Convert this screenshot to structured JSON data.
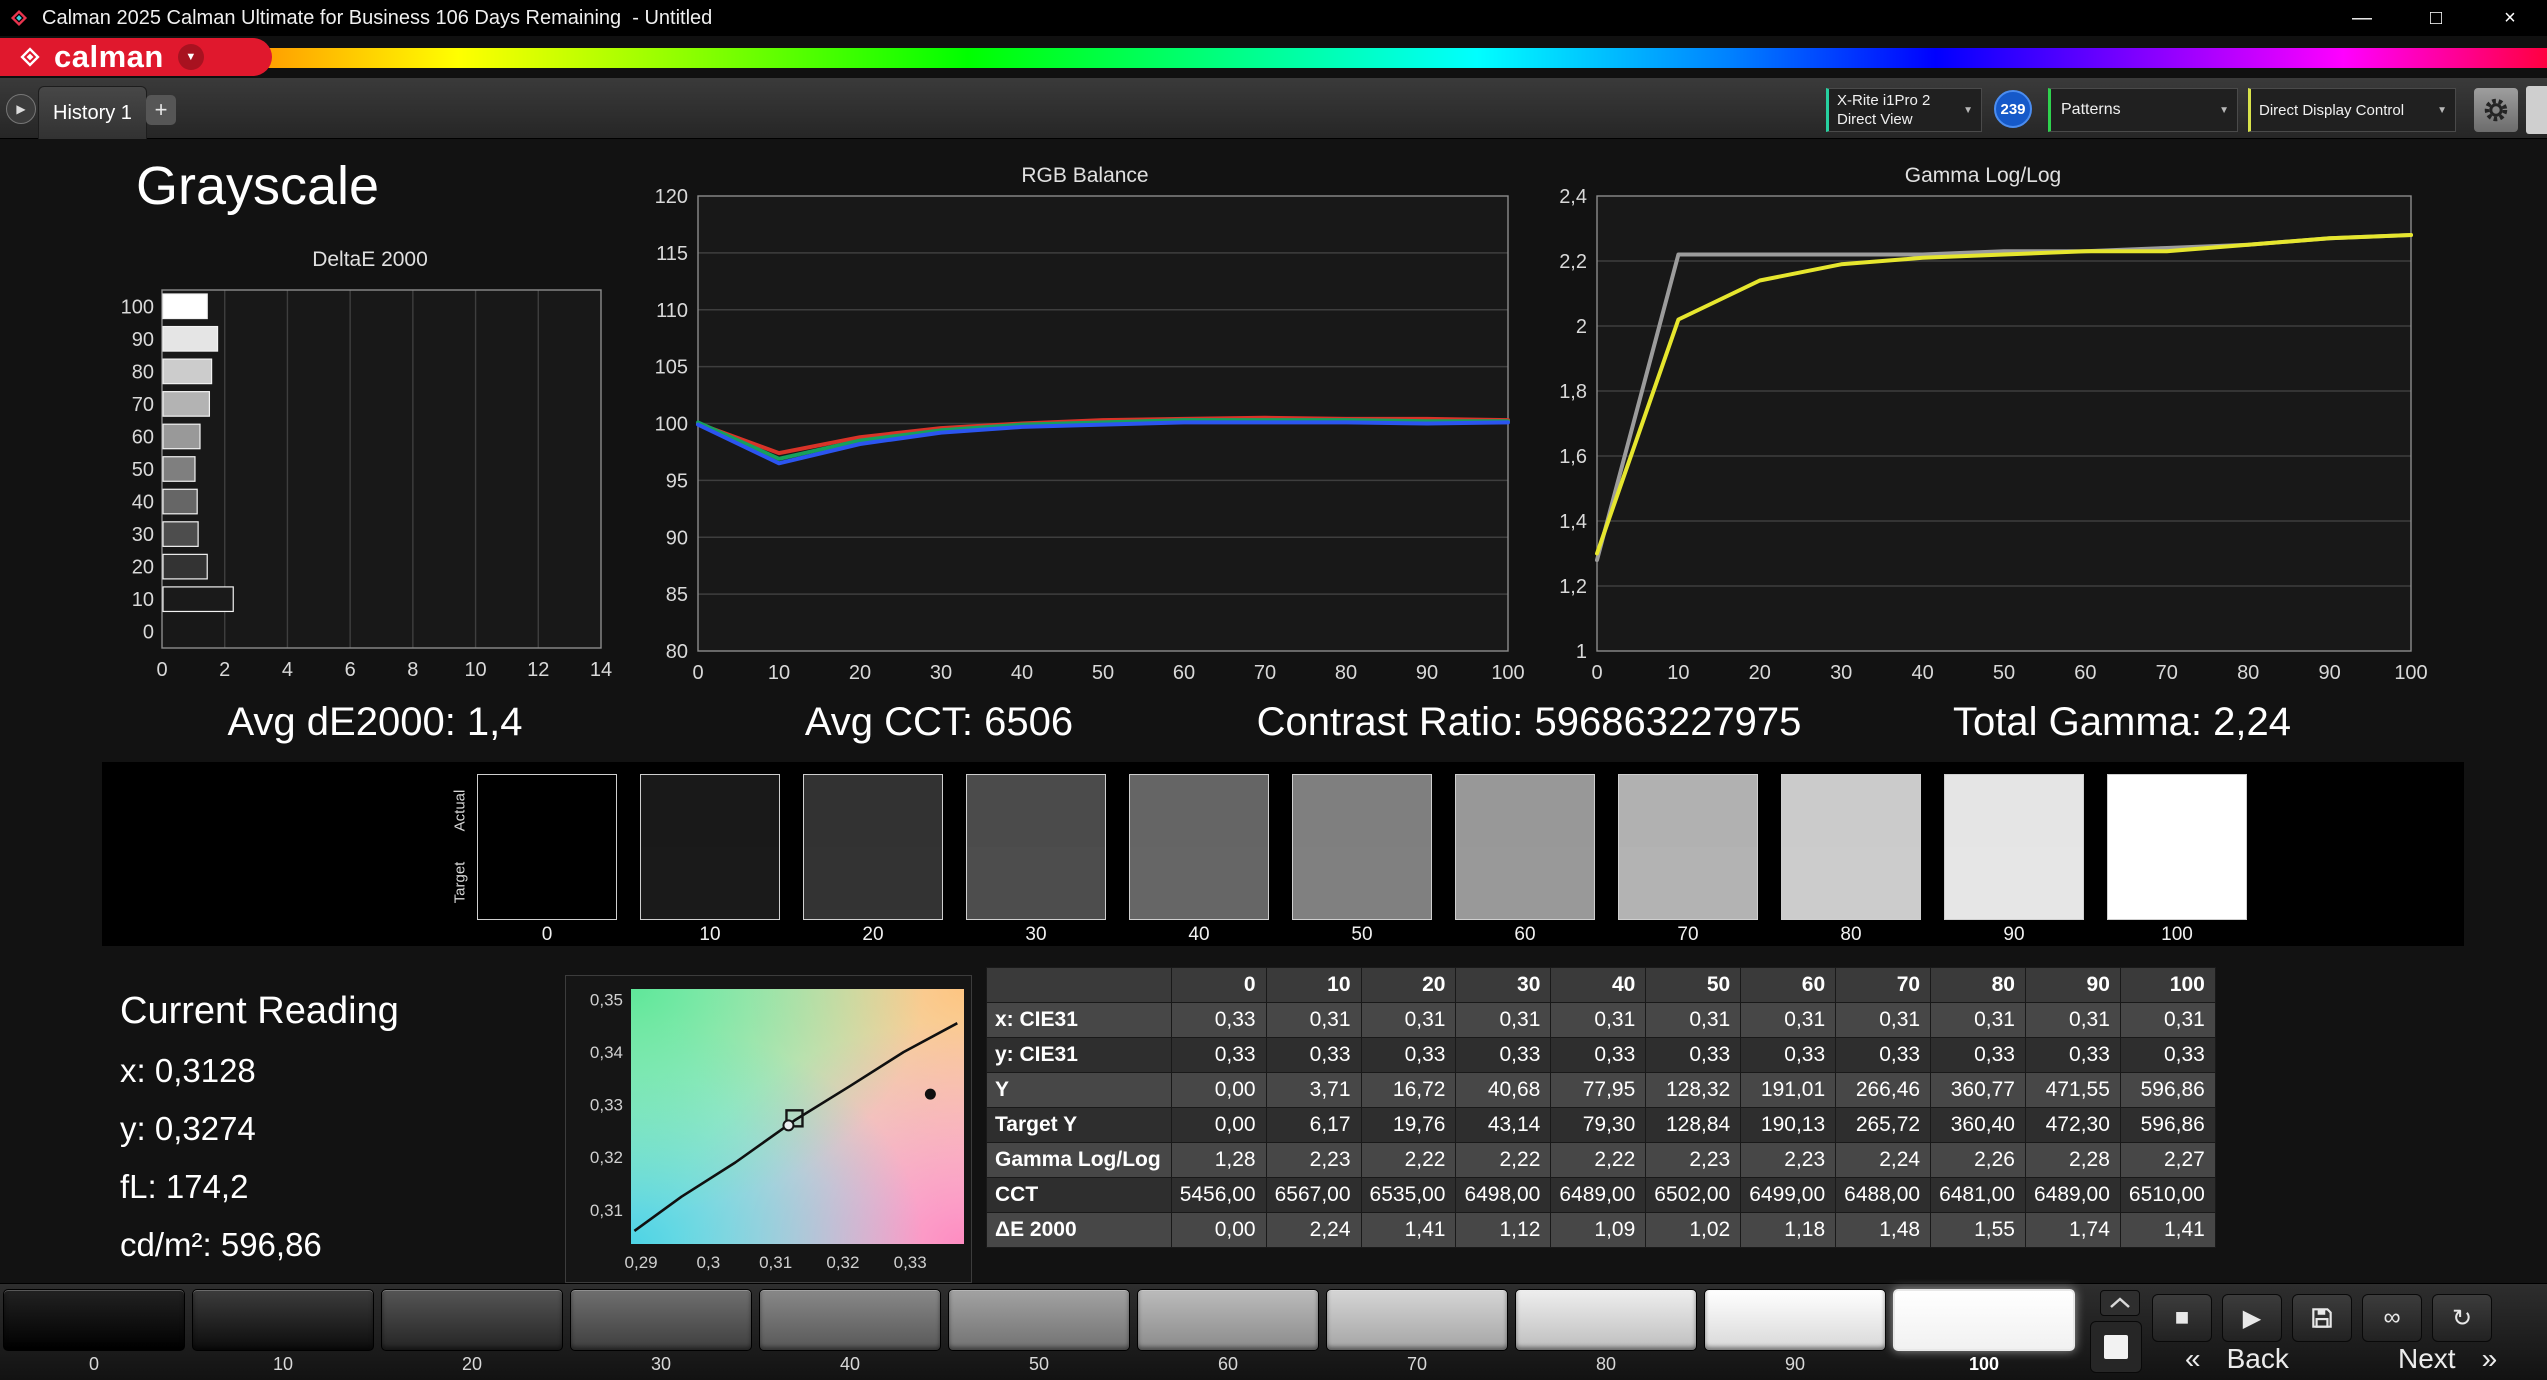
{
  "window": {
    "title": "Calman 2025 Calman Ultimate for Business 106 Days Remaining  - Untitled",
    "brand": "calman",
    "minimize_glyph": "—",
    "maximize_glyph": "□",
    "close_glyph": "×",
    "dropdown_glyph": "▼"
  },
  "toolbar": {
    "tab": "History 1",
    "add_label": "+",
    "nav_glyph": "▶",
    "meter_line1": "X-Rite i1Pro 2",
    "meter_line2": "Direct View",
    "badge": "239",
    "patterns_label": "Patterns",
    "display_control_label": "Direct Display Control",
    "chevron_glyph": "▼"
  },
  "page": {
    "title": "Grayscale"
  },
  "stats": [
    {
      "text": "Avg dE2000: 1,4"
    },
    {
      "text": "Avg CCT: 6506"
    },
    {
      "text": "Contrast Ratio: 596863227975"
    },
    {
      "text": "Total Gamma: 2,24"
    }
  ],
  "strip": {
    "actual": "Actual",
    "target": "Target"
  },
  "swatches": {
    "labels": [
      "0",
      "10",
      "20",
      "30",
      "40",
      "50",
      "60",
      "70",
      "80",
      "90",
      "100"
    ],
    "actual": [
      "#000000",
      "#191919",
      "#323232",
      "#4b4b4b",
      "#656565",
      "#7f7f7f",
      "#989898",
      "#b1b1b1",
      "#cbcbcb",
      "#e5e5e5",
      "#ffffff"
    ],
    "target": [
      "#000000",
      "#1a1a1a",
      "#333333",
      "#4d4d4d",
      "#666666",
      "#808080",
      "#999999",
      "#b3b3b3",
      "#cccccc",
      "#e6e6e6",
      "#ffffff"
    ]
  },
  "reading": {
    "title": "Current Reading",
    "lines": [
      "x: 0,3128",
      "y: 0,3274",
      "fL: 174,2",
      "cd/m²: 596,86"
    ]
  },
  "table": {
    "columns": [
      "0",
      "10",
      "20",
      "30",
      "40",
      "50",
      "60",
      "70",
      "80",
      "90",
      "100"
    ],
    "rows": [
      {
        "label": "x: CIE31",
        "values": [
          "0,33",
          "0,31",
          "0,31",
          "0,31",
          "0,31",
          "0,31",
          "0,31",
          "0,31",
          "0,31",
          "0,31",
          "0,31"
        ]
      },
      {
        "label": "y: CIE31",
        "values": [
          "0,33",
          "0,33",
          "0,33",
          "0,33",
          "0,33",
          "0,33",
          "0,33",
          "0,33",
          "0,33",
          "0,33",
          "0,33"
        ]
      },
      {
        "label": "Y",
        "values": [
          "0,00",
          "3,71",
          "16,72",
          "40,68",
          "77,95",
          "128,32",
          "191,01",
          "266,46",
          "360,77",
          "471,55",
          "596,86"
        ]
      },
      {
        "label": "Target Y",
        "values": [
          "0,00",
          "6,17",
          "19,76",
          "43,14",
          "79,30",
          "128,84",
          "190,13",
          "265,72",
          "360,40",
          "472,30",
          "596,86"
        ]
      },
      {
        "label": "Gamma Log/Log",
        "values": [
          "1,28",
          "2,23",
          "2,22",
          "2,22",
          "2,22",
          "2,23",
          "2,23",
          "2,24",
          "2,26",
          "2,28",
          "2,27"
        ]
      },
      {
        "label": "CCT",
        "values": [
          "5456,00",
          "6567,00",
          "6535,00",
          "6498,00",
          "6489,00",
          "6502,00",
          "6499,00",
          "6488,00",
          "6481,00",
          "6489,00",
          "6510,00"
        ]
      },
      {
        "label": "ΔE 2000",
        "values": [
          "0,00",
          "2,24",
          "1,41",
          "1,12",
          "1,09",
          "1,02",
          "1,18",
          "1,48",
          "1,55",
          "1,74",
          "1,41"
        ]
      }
    ]
  },
  "patterns": {
    "labels": [
      "0",
      "10",
      "20",
      "30",
      "40",
      "50",
      "60",
      "70",
      "80",
      "90",
      "100"
    ],
    "selected_index": 10
  },
  "transport": {
    "back": "Back",
    "next": "Next",
    "back_chevron": "«",
    "next_chevron": "»",
    "stop_glyph": "■",
    "play_glyph": "▶",
    "loop_glyph": "∞",
    "refresh_glyph": "↻"
  },
  "chart_data": [
    {
      "type": "bar",
      "title": "DeltaE 2000",
      "orientation": "horizontal",
      "categories": [
        100,
        90,
        80,
        70,
        60,
        50,
        40,
        30,
        20,
        10,
        0
      ],
      "values": [
        1.41,
        1.74,
        1.55,
        1.48,
        1.18,
        1.02,
        1.09,
        1.12,
        1.41,
        2.24,
        0.0
      ],
      "xlim": [
        0,
        14
      ],
      "xticks": [
        0,
        2,
        4,
        6,
        8,
        10,
        12,
        14
      ],
      "grid": true
    },
    {
      "type": "line",
      "title": "RGB Balance",
      "x": [
        0,
        10,
        20,
        30,
        40,
        50,
        60,
        70,
        80,
        90,
        100
      ],
      "ylim": [
        80,
        120
      ],
      "yticks": [
        80,
        85,
        90,
        95,
        100,
        105,
        110,
        115,
        120
      ],
      "ytick_labels": [
        "80",
        "85",
        "90",
        "95",
        "100",
        "105",
        "110",
        "115",
        "120"
      ],
      "grid": true,
      "series": [
        {
          "name": "Red",
          "color": "#d93328",
          "values": [
            100.0,
            97.4,
            98.8,
            99.6,
            100.0,
            100.3,
            100.4,
            100.5,
            100.4,
            100.4,
            100.3
          ]
        },
        {
          "name": "Green",
          "color": "#16a05c",
          "values": [
            100.1,
            96.9,
            98.5,
            99.4,
            99.9,
            100.1,
            100.3,
            100.3,
            100.3,
            100.2,
            100.2
          ]
        },
        {
          "name": "Blue",
          "color": "#2b55f0",
          "values": [
            99.9,
            96.5,
            98.2,
            99.2,
            99.7,
            99.9,
            100.1,
            100.1,
            100.1,
            100.0,
            100.1
          ]
        }
      ]
    },
    {
      "type": "line",
      "title": "Gamma Log/Log",
      "x": [
        0,
        10,
        20,
        30,
        40,
        50,
        60,
        70,
        80,
        90,
        100
      ],
      "ylim": [
        1,
        2.4
      ],
      "yticks": [
        1,
        1.2,
        1.4,
        1.6,
        1.8,
        2,
        2.2,
        2.4
      ],
      "ytick_labels": [
        "1",
        "1,2",
        "1,4",
        "1,6",
        "1,8",
        "2",
        "2,2",
        "2,4"
      ],
      "grid": true,
      "series": [
        {
          "name": "Target gamma",
          "color": "#9c9c9c",
          "values": [
            1.28,
            2.22,
            2.22,
            2.22,
            2.22,
            2.23,
            2.23,
            2.24,
            2.25,
            2.27,
            2.28
          ]
        },
        {
          "name": "Measured gamma",
          "color": "#e6e62e",
          "values": [
            1.3,
            2.02,
            2.14,
            2.19,
            2.21,
            2.22,
            2.23,
            2.23,
            2.25,
            2.27,
            2.28
          ]
        }
      ]
    },
    {
      "type": "scatter",
      "title": "CIE chromaticity",
      "xlim": [
        0.2885,
        0.338
      ],
      "ylim": [
        0.3035,
        0.352
      ],
      "xticks": [
        0.29,
        0.3,
        0.31,
        0.32,
        0.33
      ],
      "xtick_labels": [
        "0,29",
        "0,3",
        "0,31",
        "0,32",
        "0,33"
      ],
      "yticks": [
        0.31,
        0.32,
        0.33,
        0.34,
        0.35
      ],
      "ytick_labels": [
        "0,31",
        "0,32",
        "0,33",
        "0,34",
        "0,35"
      ],
      "curve": [
        [
          0.289,
          0.306
        ],
        [
          0.296,
          0.3125
        ],
        [
          0.304,
          0.319
        ],
        [
          0.3128,
          0.327
        ],
        [
          0.321,
          0.3335
        ],
        [
          0.329,
          0.34
        ],
        [
          0.337,
          0.3455
        ]
      ],
      "points": [
        {
          "name": "measured",
          "x": 0.3128,
          "y": 0.3274
        },
        {
          "name": "reference",
          "x": 0.333,
          "y": 0.332
        }
      ]
    }
  ]
}
